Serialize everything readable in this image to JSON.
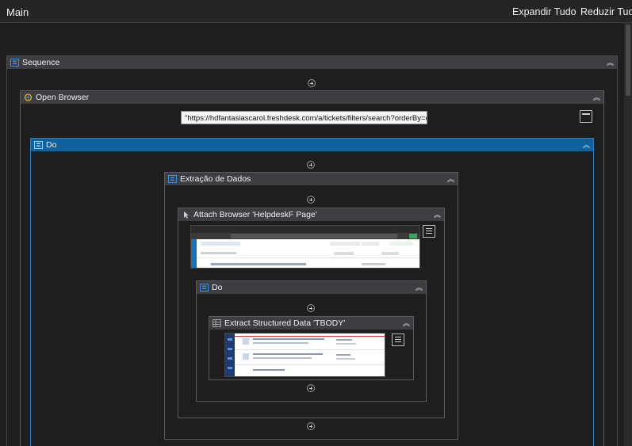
{
  "topbar": {
    "title": "Main",
    "expand_all": "Expandir Tudo",
    "collapse_all": "Reduzir Tudo"
  },
  "activities": {
    "sequence": {
      "label": "Sequence"
    },
    "open_browser": {
      "label": "Open Browser",
      "url": "\"https://hdfantasiascarol.freshdesk.com/a/tickets/filters/search?orderBy=c"
    },
    "do_outer": {
      "label": "Do"
    },
    "extracao": {
      "label": "Extração de Dados"
    },
    "attach_browser": {
      "label": "Attach Browser 'HelpdeskF Page'"
    },
    "do_inner": {
      "label": "Do"
    },
    "extract": {
      "label": "Extract Structured Data 'TBODY'"
    }
  },
  "colors": {
    "background": "#1e1e1e",
    "header": "#3e3e42",
    "selected_header": "#0e639c",
    "border": "#5a5a5a"
  },
  "icons": {
    "sequence": "sequence-icon",
    "open_browser": "globe-icon",
    "do": "sequence-icon",
    "attach": "cursor-icon",
    "extract": "table-icon",
    "collapse": "double-chevron-up-icon",
    "add": "plus-circle-icon",
    "options": "hamburger-icon"
  }
}
